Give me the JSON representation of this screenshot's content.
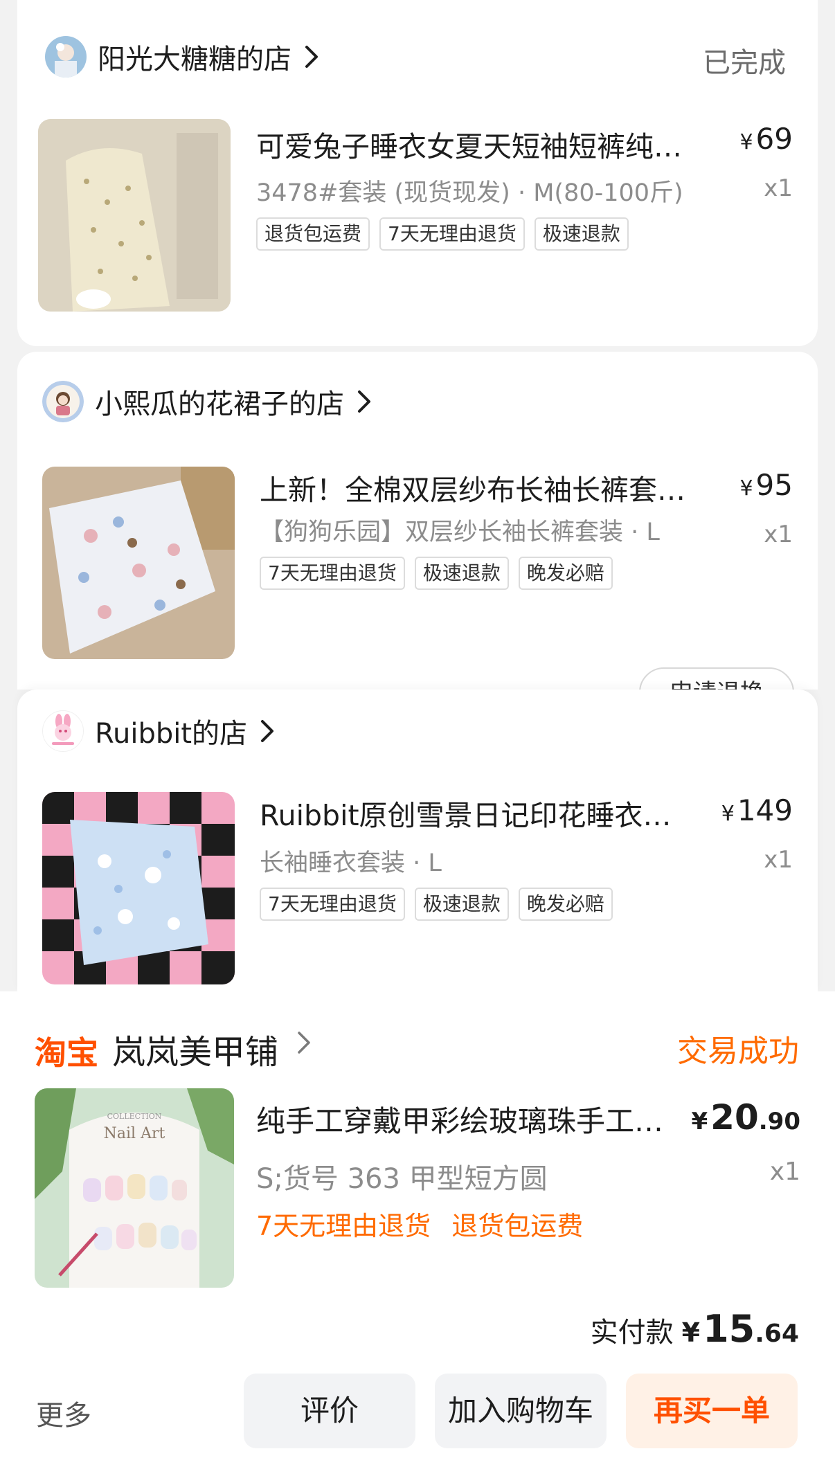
{
  "orders": [
    {
      "shop_name": "阳光大糖糖的店",
      "status": "已完成",
      "title": "可爱兔子睡衣女夏天短袖短裤纯…",
      "currency": "¥",
      "price": "69",
      "sku": "3478#套装 (现货现发) · M(80-100斤)",
      "qty": "x1",
      "tags": [
        "退货包运费",
        "7天无理由退货",
        "极速退款"
      ]
    },
    {
      "shop_name": "小熙瓜的花裙子的店",
      "title": "上新！全棉双层纱布长袖长裤套…",
      "currency": "¥",
      "price": "95",
      "sku": "【狗狗乐园】双层纱长袖长裤套装 · L",
      "qty": "x1",
      "tags": [
        "7天无理由退货",
        "极速退款",
        "晚发必赔"
      ],
      "partial_button": "申请退换"
    },
    {
      "shop_name": "Ruibbit的店",
      "title": "Ruibbit原创雪景日记印花睡衣…",
      "currency": "¥",
      "price": "149",
      "sku": "长袖睡衣套装 · L",
      "qty": "x1",
      "tags": [
        "7天无理由退货",
        "极速退款",
        "晚发必赔"
      ]
    },
    {
      "brand": "淘宝",
      "shop_name": "岚岚美甲铺",
      "status": "交易成功",
      "title": "纯手工穿戴甲彩绘玻璃珠手工穿…",
      "currency": "¥",
      "price_int": "20",
      "price_dec": ".90",
      "sku": "S;货号 363 甲型短方圆",
      "qty": "x1",
      "tags": [
        "7天无理由退货",
        "退货包运费"
      ],
      "paid_label": "实付款",
      "paid_int": "15",
      "paid_dec": ".64",
      "thumb_text": "Nail Art",
      "thumb_small_text": "COLLECTION"
    }
  ],
  "actions": {
    "more": "更多",
    "review": "评价",
    "add_cart": "加入购物车",
    "rebuy": "再买一单"
  },
  "colors": {
    "accent": "#ff5000",
    "status_orange": "#ff6a00",
    "muted": "#8c8c8c",
    "background": "#f2f2f2"
  }
}
